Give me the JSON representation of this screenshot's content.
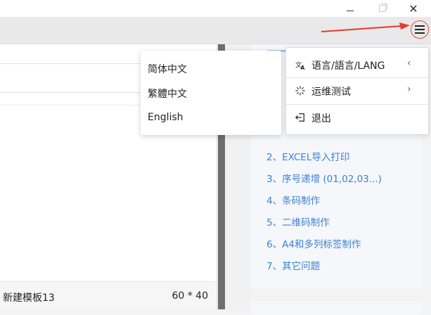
{
  "window": {
    "minimize_icon": "minimize-icon",
    "maximize_icon": "maximize-icon",
    "close_glyph": "✕"
  },
  "toolbar": {
    "menu_icon": "hamburger-menu-icon",
    "accent": "#e74c3c"
  },
  "main_menu": {
    "items": [
      {
        "label": "语言/語言/LANG",
        "icon": "translate-icon",
        "chevron": "‹"
      },
      {
        "label": "运维测试",
        "icon": "loading-spinner-icon",
        "chevron": "›"
      },
      {
        "label": "退出",
        "icon": "exit-icon"
      }
    ]
  },
  "language_menu": {
    "options": [
      "简体中文",
      "繁體中文",
      "English"
    ]
  },
  "help": {
    "link_color": "#3b82d6",
    "items": [
      "2、EXCEL导入打印",
      "3、序号递增 (01,02,03...)",
      "4、条码制作",
      "5、二维码制作",
      "6、A4和多列标签制作",
      "7、其它问题"
    ]
  },
  "status": {
    "template_name": "新建模板13",
    "label_size": "60 * 40"
  }
}
